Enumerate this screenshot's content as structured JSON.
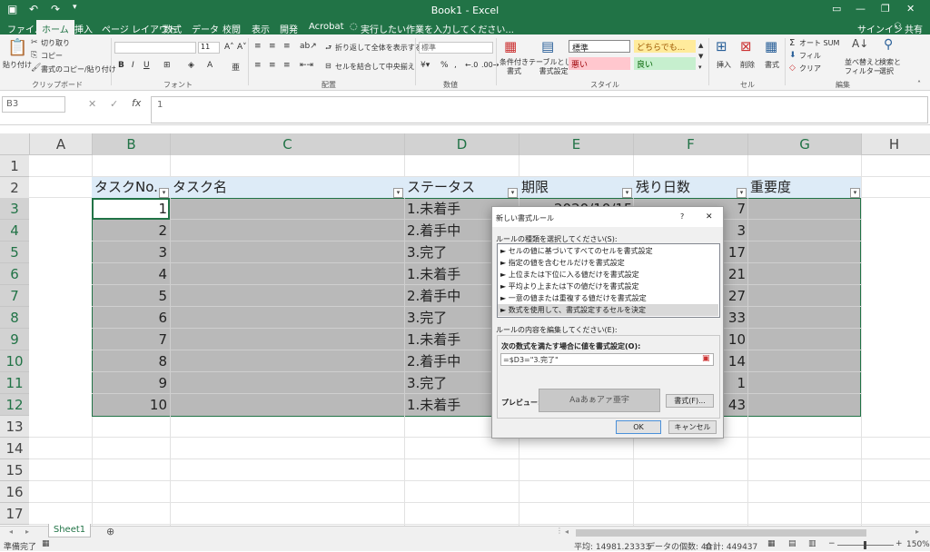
{
  "window": {
    "title": "Book1 - Excel",
    "signin": "サインイン",
    "share": "共有"
  },
  "tabs": [
    "ファイル",
    "ホーム",
    "挿入",
    "ページ レイアウト",
    "数式",
    "データ",
    "校閲",
    "表示",
    "開発",
    "Acrobat"
  ],
  "tell_me": "実行したい作業を入力してください...",
  "ribbon": {
    "clipboard": {
      "paste": "貼り付け",
      "cut": "切り取り",
      "copy": "コピー",
      "format_painter": "書式のコピー/貼り付け",
      "label": "クリップボード"
    },
    "font": {
      "size": "11",
      "label": "フォント"
    },
    "alignment": {
      "wrap": "折り返して全体を表示する",
      "merge": "セルを結合して中央揃え",
      "label": "配置"
    },
    "number": {
      "format": "標準",
      "label": "数値"
    },
    "styles": {
      "conditional": "条件付き\n書式",
      "table": "テーブルとして\n書式設定",
      "standard": "標準",
      "neutral": "どちらでも...",
      "bad": "悪い",
      "good": "良い",
      "label": "スタイル"
    },
    "cells": {
      "insert": "挿入",
      "delete": "削除",
      "format": "書式",
      "label": "セル"
    },
    "editing": {
      "autosum": "オート SUM",
      "fill": "フィル",
      "clear": "クリア",
      "sort": "並べ替えと\nフィルター",
      "find": "検索と\n選択",
      "label": "編集"
    }
  },
  "formula_bar": {
    "namebox": "B3",
    "value": "1"
  },
  "columns": [
    "A",
    "B",
    "C",
    "D",
    "E",
    "F",
    "G",
    "H"
  ],
  "rows": [
    "1",
    "2",
    "3",
    "4",
    "5",
    "6",
    "7",
    "8",
    "9",
    "10",
    "11",
    "12",
    "13",
    "14",
    "15",
    "16",
    "17"
  ],
  "table": {
    "headers": {
      "b": "タスクNo.",
      "c": "タスク名",
      "d": "ステータス",
      "e": "期限",
      "f": "残り日数",
      "g": "重要度"
    },
    "e3_partial": "2020/10/15",
    "rows": [
      {
        "no": "1",
        "status": "1.未着手",
        "remain": "7"
      },
      {
        "no": "2",
        "status": "2.着手中",
        "remain": "3"
      },
      {
        "no": "3",
        "status": "3.完了",
        "remain": "17"
      },
      {
        "no": "4",
        "status": "1.未着手",
        "remain": "21"
      },
      {
        "no": "5",
        "status": "2.着手中",
        "remain": "27"
      },
      {
        "no": "6",
        "status": "3.完了",
        "remain": "33"
      },
      {
        "no": "7",
        "status": "1.未着手",
        "remain": "10"
      },
      {
        "no": "8",
        "status": "2.着手中",
        "remain": "14"
      },
      {
        "no": "9",
        "status": "3.完了",
        "remain": "1"
      },
      {
        "no": "10",
        "status": "1.未着手",
        "remain": "43"
      }
    ]
  },
  "dialog": {
    "title": "新しい書式ルール",
    "help": "?",
    "close": "✕",
    "rule_type_label": "ルールの種類を選択してください(S):",
    "rule_types": [
      "セルの値に基づいてすべてのセルを書式設定",
      "指定の値を含むセルだけを書式設定",
      "上位または下位に入る値だけを書式設定",
      "平均より上または下の値だけを書式設定",
      "一意の値または重複する値だけを書式設定",
      "数式を使用して、書式設定するセルを決定"
    ],
    "edit_label": "ルールの内容を編集してください(E):",
    "formula_label": "次の数式を満たす場合に値を書式設定(O):",
    "formula": "=$D3=\"3.完了\"",
    "preview_label": "プレビュー:",
    "preview_text": "Aaあぁアァ亜宇",
    "format_button": "書式(F)...",
    "ok": "OK",
    "cancel": "キャンセル"
  },
  "sheet_tab": "Sheet1",
  "status": {
    "ready": "準備完了",
    "average": "平均: 14981.23333",
    "count": "データの個数: 40",
    "sum": "合計: 449437",
    "zoom": "150%"
  },
  "colors": {
    "excel_green": "#217346",
    "header_fill": "#ddebf7",
    "selection": "#b9b9b9"
  }
}
